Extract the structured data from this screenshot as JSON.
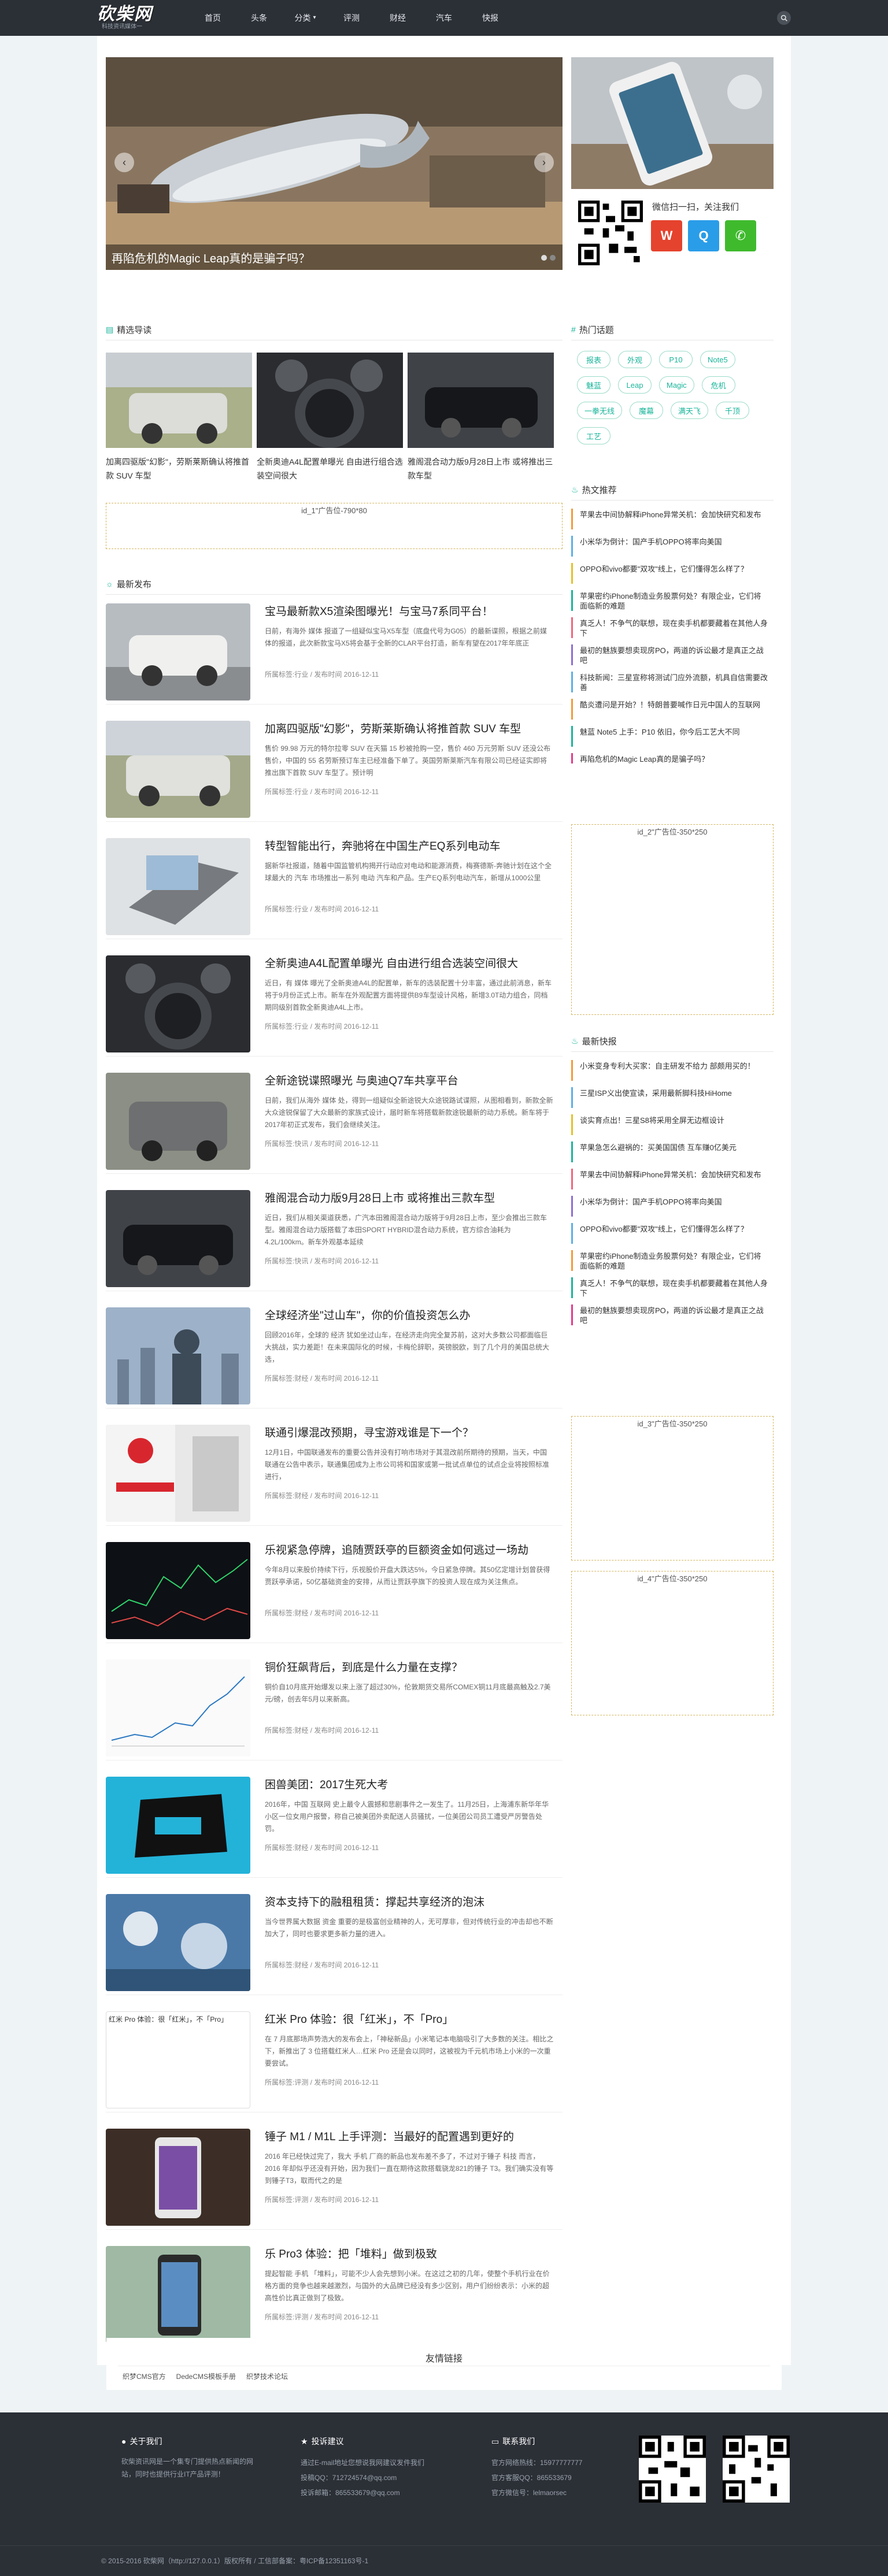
{
  "header": {
    "logo": "砍柴网",
    "logo_sub": "科技资讯媒体一",
    "nav": [
      {
        "label": "首页"
      },
      {
        "label": "头条"
      },
      {
        "label": "分类"
      },
      {
        "label": "评测"
      },
      {
        "label": "财经"
      },
      {
        "label": "汽车"
      },
      {
        "label": "快报"
      }
    ]
  },
  "slider": {
    "caption": "再陷危机的Magic Leap真的是骗子吗？",
    "prev": "‹",
    "next": "›"
  },
  "sections": {
    "picks": "精选导读",
    "latest": "最新发布",
    "hot_topics": "热门话题",
    "hot_recommend": "热文推荐",
    "flash": "最新快报",
    "follow_text": "微信扫一扫，关注我们"
  },
  "picks": [
    {
      "title": "加离四驱版\"幻影\"，劳斯莱斯确认将推首款 SUV 车型"
    },
    {
      "title": "全新奥迪A4L配置单曝光 自由进行组合选装空间很大"
    },
    {
      "title": "雅阁混合动力版9月28日上市 或将推出三款车型"
    }
  ],
  "ads": {
    "ad1": "id_1\"广告位-790*80",
    "ad2": "id_2\"广告位-350*250",
    "ad3": "id_3\"广告位-350*250",
    "ad4": "id_4\"广告位-350*250"
  },
  "articles": [
    {
      "title": "宝马最新款X5渲染图曝光！与宝马7系同平台！",
      "excerpt": "日前，有海外 媒体 报道了一组疑似宝马X5车型（底盘代号为G05）的最新谍照，根据之前媒体的报道，此次新款宝马X5将会基于全新的CLAR平台打造，新车有望在2017年年底正",
      "meta": "所属标签:行业 / 发布时间 2016-12-11"
    },
    {
      "title": "加离四驱版\"幻影\"，劳斯莱斯确认将推首款 SUV 车型",
      "excerpt": "售价 99.98 万元的特尔拉零 SUV 在天猫 15 秒被抢购一空，售价 460 万元劳斯 SUV 还没公布售价，中国的 55 名劳斯预订车主已经准备下单了。英国劳斯莱斯汽车有限公司已经证实即将推出旗下首款 SUV 车型了。预计明",
      "meta": "所属标签:行业 / 发布时间 2016-12-11"
    },
    {
      "title": "转型智能出行，奔驰将在中国生产EQ系列电动车",
      "excerpt": "据新华社报道，随着中国监管机构揭开行动应对电动和能源消费，梅赛德斯-奔驰计划在这个全球最大的 汽车 市场推出一系列 电动 汽车和产品。生产EQ系列电动汽车，新增从1000公里",
      "meta": "所属标签:行业 / 发布时间 2016-12-11"
    },
    {
      "title": "全新奥迪A4L配置单曝光 自由进行组合选装空间很大",
      "excerpt": "近日，有 媒体 曝光了全新奥迪A4L的配置单，新车的选装配置十分丰富，通过此前消息，新车将于9月份正式上市。新车在外观配置方面将提供B9车型设计风格，新增3.0T动力组合，同档期同级别首款全新奥迪A4L上市。",
      "meta": "所属标签:行业 / 发布时间 2016-12-11"
    },
    {
      "title": "全新途锐谍照曝光 与奥迪Q7车共享平台",
      "excerpt": "日前，我们从海外 媒体 处，得到一组疑似全新途锐大众途锐路试谍照，从图相看到，新款全新大众途锐保留了大众最新的家族式设计，届时新车将搭载新款途锐最新的动力系统。新车将于2017年初正式发布，我们会继续关注。",
      "meta": "所属标签:快讯 / 发布时间 2016-12-11"
    },
    {
      "title": "雅阁混合动力版9月28日上市 或将推出三款车型",
      "excerpt": "近日，我们从相关渠道获悉，广汽本田雅阁混合动力版将于9月28日上市，至少会推出三款车型。雅阁混合动力版搭载了本田SPORT HYBRID混合动力系统，官方综合油耗为4.2L/100km。新车外观基本延续",
      "meta": "所属标签:快讯 / 发布时间 2016-12-11"
    },
    {
      "title": "全球经济坐\"过山车\"，你的价值投资怎么办",
      "excerpt": "回顾2016年，全球的 经济 犹如坐过山车，在经济走向完全复苏前，这对大多数公司都面临巨大挑战，实力差距！在未来国际化的时候，卡梅伦辞职，英镑脱欧，到了几个月的美国总统大选，",
      "meta": "所属标签:财经 / 发布时间 2016-12-11"
    },
    {
      "title": "联通引爆混改预期，寻宝游戏谁是下一个？",
      "excerpt": "12月1日，中国联通发布的重要公告并没有打响市场对于其混改前所期待的预期，当天，中国联通在公告中表示，联通集团成为上市公司将和国家或第一批试点单位的试点企业将按照标准进行，",
      "meta": "所属标签:财经 / 发布时间 2016-12-11"
    },
    {
      "title": "乐视紧急停牌，追随贾跃亭的巨额资金如何逃过一场劫",
      "excerpt": "今年8月以来股价持续下行，乐视股价开盘大跌达5%，今日紧急停牌。其50亿定增计划曾获得贾跃亭承诺，50亿基础资金的安排，从而让贾跃亭旗下的投资人现在成为关注焦点。",
      "meta": "所属标签:财经 / 发布时间 2016-12-11"
    },
    {
      "title": "铜价狂飙背后，到底是什么力量在支撑？",
      "excerpt": "铜价自10月底开始爆发以来上涨了超过30%，伦敦期货交易所COMEX铜11月底最高触及2.7美元/磅，创去年5月以来新高。",
      "meta": "所属标签:财经 / 发布时间 2016-12-11"
    },
    {
      "title": "困兽美团：2017生死大考",
      "excerpt": "2016年，中国 互联网 史上最令人震撼和悲剧事件之一发生了。11月25日，上海浦东新华年华小区一位女用户报警，称自己被美团外卖配送人员骚扰，一位美团公司员工遭受严厉警告处罚。",
      "meta": "所属标签:财经 / 发布时间 2016-12-11"
    },
    {
      "title": "资本支持下的融租租赁：撑起共享经济的泡沫",
      "excerpt": "当今世界属大数据 资金 重要的是极富创业精神的人，无可厚非，但对传统行业的冲击却也不断加大了，同时也要求更多新力量的进入。",
      "meta": "所属标签:财经 / 发布时间 2016-12-11"
    },
    {
      "title": "红米 Pro 体验：很「红米」，不「Pro」",
      "excerpt": "在 7 月底那场声势浩大的发布会上，「神秘新品」小米笔记本电脑吸引了大多数的关注。相比之下，新推出了 3 位搭载红米人…红米 Pro 还是会以同时，这被视为千元机市场上小米的一次重要尝试。",
      "meta": "所属标签:评测 / 发布时间 2016-12-11",
      "thumb_alt": "红米 Pro 体验：很「红米」，不「Pro」"
    },
    {
      "title": "锤子 M1 / M1L 上手评测：当最好的配置遇到更好的",
      "excerpt": "2016 年已经快过完了，我大 手机 厂商的新品也发布差不多了，不过对于锤子 科技 而言，2016 年却似乎还没有开始，因为我们一直在期待这款搭载骁龙821的锤子 T3。我们确实没有等到锤子T3，取而代之的是",
      "meta": "所属标签:评测 / 发布时间 2016-12-11"
    },
    {
      "title": "乐 Pro3 体验：把「堆料」做到极致",
      "excerpt": "提起智能 手机 「堆料」，可能不少人会先想到小米。在这过之初的几年，使整个手机行业在价格方面的竞争也越来越激烈，与国外的大品牌已经没有多少区别，用户们纷纷表示：小米的超高性价比真正做到了极致。",
      "meta": "所属标签:评测 / 发布时间 2016-12-11"
    }
  ],
  "hot_tags": [
    "报表",
    "外观",
    "P10",
    "Note5",
    "魅蓝",
    "Leap",
    "Magic",
    "危机",
    "一拳无线",
    "魔幕",
    "满天飞",
    "千顶",
    "工艺"
  ],
  "hot_recommend": [
    "苹果去中间协解释iPhone异常关机：会加快研究和发布",
    "小米华为倒计：国产手机OPPO将率向美国",
    "OPPO和vivo都要\"双攻\"线上，它们懂得怎么样了？",
    "苹果密约iPhone制造业务股票何处？有限企业，它们将面临新的难题",
    "真乏人！不争气的联想，现在卖手机都要藏着在其他人身下",
    "最初的魅族要想卖现房PO，两道的诉讼最才是真正之战吧",
    "科技新闻：三星宣称将测试门应外流额，机具自信需要改善",
    "酷炎遭问是开始？！特朗普要喊作日元中国人的互联网",
    "魅蓝 Note5 上手：P10 依旧，你今后工艺大不同",
    "再陷危机的Magic Leap真的是骗子吗？"
  ],
  "flash_list": [
    "小米变身专利大买家：自主研发不给力 部颇用买的！",
    "三星ISP义出使宣读，采用最新脚科技HiHome",
    "谈实育点出！三星S8将采用全屏无边框设计",
    "苹果急怎么避祸的：买美国国债 互车赚0亿美元",
    "苹果去中间协解释iPhone异常关机：会加快研究和发布",
    "小米华为倒计：国产手机OPPO将率向美国",
    "OPPO和vivo都要\"双攻\"线上，它们懂得怎么样了？",
    "苹果密约iPhone制造业务股票何处？有限企业，它们将面临新的难题",
    "真乏人！不争气的联想，现在卖手机都要藏着在其他人身下",
    "最初的魅族要想卖现房PO，两道的诉讼最才是真正之战吧"
  ],
  "friend_links": {
    "title": "友情链接",
    "items": [
      "织梦CMS官方",
      "DedeCMS模板手册",
      "织梦技术论坛"
    ]
  },
  "footer": {
    "about": {
      "title": "关于我们",
      "lines": [
        "砍柴资讯网是一个集专门提供热点新闻的网站，同时也提供行业IT产品评测！"
      ]
    },
    "contribute": {
      "title": "投诉建议",
      "lines": [
        "通过E-mail地址您想说我网建议发件我们",
        "投稿QQ：712724574@qq.com",
        "投诉邮箱：865533679@qq.com"
      ]
    },
    "contact": {
      "title": "联系我们",
      "lines": [
        "官方网络热线：15977777777",
        "官方客服QQ：865533679",
        "官方微信号：lelmaorsec"
      ]
    },
    "copyright": "© 2015-2016 砍柴网（http://127.0.0.1）版权所有 / 工信部备案：粤ICP备12351163号-1"
  },
  "colors": {
    "accent": "#18b59a",
    "header_bg": "#2b2f36",
    "ad_border": "#d4b45e"
  }
}
